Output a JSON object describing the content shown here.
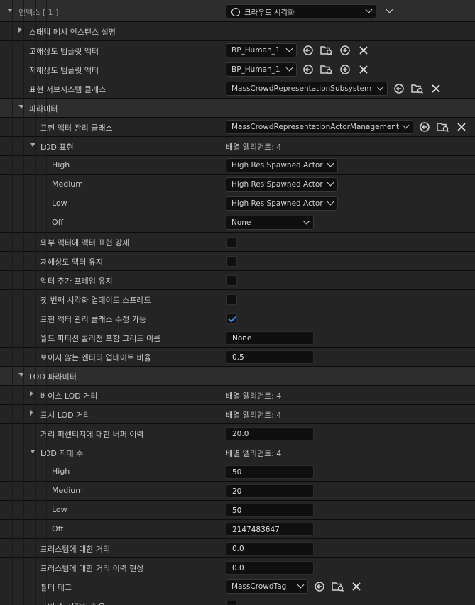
{
  "header": {
    "label": "인덱스 [ 1 ]",
    "value": "크라우드 시각화"
  },
  "rows": {
    "static_mesh_desc": "스태틱 메시 인스턴스 설명",
    "high_template": {
      "label": "고해상도 템플릿 액터",
      "value": "BP_Human_1"
    },
    "low_template": {
      "label": "저해상도 템플릿 액터",
      "value": "BP_Human_1"
    },
    "rep_subsystem": {
      "label": "표현 서브시스템 클래스",
      "value": "MassCrowdRepresentationSubsystem"
    },
    "params": "파라미터",
    "actor_mgmt": {
      "label": "표현 액터 관리 클래스",
      "value": "MassCrowdRepresentationActorManagement"
    },
    "lod_rep": {
      "label": "LOD 표현",
      "value": "배열 엘리먼트: 4"
    },
    "lod_high": {
      "label": "High",
      "value": "High Res Spawned Actor"
    },
    "lod_medium": {
      "label": "Medium",
      "value": "High Res Spawned Actor"
    },
    "lod_low": {
      "label": "Low",
      "value": "High Res Spawned Actor"
    },
    "lod_off": {
      "label": "Off",
      "value": "None"
    },
    "force_ext": "외부 액터에 액터 표현 강제",
    "keep_low": "저해상도 액터 유지",
    "keep_frame": "액터 추가 프레임 유지",
    "spread_first": "첫 번째 시각화 업데이트 스프레드",
    "mgmt_editable": "표현 액터 관리 클래스 수정 가능",
    "world_partition": {
      "label": "월드 파티션 콜리전 포함 그리드 이름",
      "value": "None"
    },
    "invisible_ratio": {
      "label": "보이지 않는 엔티티 업데이트 비율",
      "value": "0.5"
    },
    "lod_params": "LOD 파라미터",
    "base_lod": {
      "label": "베이스 LOD 거리",
      "value": "배열 엘리먼트: 4"
    },
    "visible_lod": {
      "label": "표시 LOD 거리",
      "value": "배열 엘리먼트: 4"
    },
    "buffer_hyst": {
      "label": "거리 퍼센티지에 대한 버퍼 이력",
      "value": "20.0"
    },
    "lod_max": {
      "label": "LOD 최대 수",
      "value": "배열 엘리먼트: 4"
    },
    "max_high": {
      "label": "High",
      "value": "50"
    },
    "max_medium": {
      "label": "Medium",
      "value": "20"
    },
    "max_low": {
      "label": "Low",
      "value": "50"
    },
    "max_off": {
      "label": "Off",
      "value": "2147483647"
    },
    "frustum_dist": {
      "label": "프러스텀에 대한 거리",
      "value": "0.0"
    },
    "frustum_hyst": {
      "label": "프러스텀에 대한 거리 이력 현상",
      "value": "0.0"
    },
    "filter_tag": {
      "label": "필터 태그",
      "value": "MassCrowdTag"
    },
    "last": "서버 측 시각화 허용"
  },
  "checks": {
    "force_ext": false,
    "keep_low": false,
    "keep_frame": false,
    "spread_first": false,
    "mgmt_editable": true,
    "last": false
  },
  "colors": {
    "accent": "#3a8df0",
    "background": "#242424"
  },
  "icons": [
    "reset-arrow-icon",
    "browse-folder-icon",
    "add-icon",
    "clear-icon"
  ]
}
